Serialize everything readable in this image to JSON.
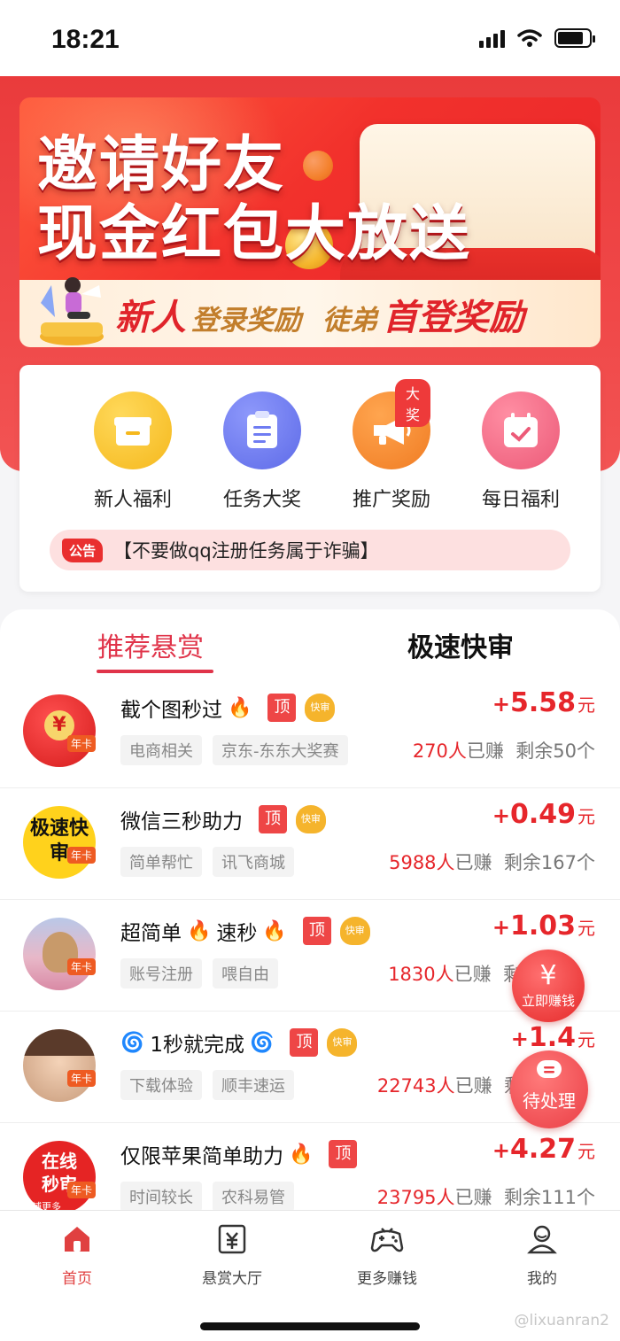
{
  "status_bar": {
    "time": "18:21"
  },
  "banner": {
    "title_line1": "邀请好友",
    "title_line2": "现金红包大放送",
    "strip_new": "新人",
    "strip_login": "登录奖励",
    "strip_apprentice": "徒弟",
    "strip_first": "首登奖励"
  },
  "quick_actions": [
    {
      "label": "新人福利",
      "icon": "gift-box-icon",
      "color": "#f7c027"
    },
    {
      "label": "任务大奖",
      "icon": "clipboard-icon",
      "color": "#6f7cf2"
    },
    {
      "label": "推广奖励",
      "icon": "megaphone-icon",
      "color": "#f5872d",
      "badge": "大奖"
    },
    {
      "label": "每日福利",
      "icon": "calendar-check-icon",
      "color": "#f1607a"
    }
  ],
  "notice": {
    "tag": "公告",
    "text": "【不要做qq注册任务属于诈骗】"
  },
  "tabs": {
    "recommended": "推荐悬赏",
    "fast": "极速快审"
  },
  "tasks": [
    {
      "title": "截个图秒过",
      "top": "顶",
      "fast": "快审",
      "tags": [
        "电商相关",
        "京东-东东大奖赛"
      ],
      "plus": "+",
      "price": "5.58",
      "unit": "元",
      "earned": "270人",
      "earned_suffix": "已赚",
      "remaining": "剩余50个",
      "avatar_text": "¥",
      "avatar_badge": "年卡"
    },
    {
      "title": "微信三秒助力",
      "top": "顶",
      "fast": "快审",
      "tags": [
        "简单帮忙",
        "讯飞商城"
      ],
      "plus": "+",
      "price": "0.49",
      "unit": "元",
      "earned": "5988人",
      "earned_suffix": "已赚",
      "remaining": "剩余167个",
      "avatar_text": "极速快审",
      "avatar_badge": "年卡"
    },
    {
      "title_a": "超简单",
      "title_b": "速秒",
      "top": "顶",
      "fast": "快审",
      "tags": [
        "账号注册",
        "喂自由"
      ],
      "plus": "+",
      "price": "1.03",
      "unit": "元",
      "earned": "1830人",
      "earned_suffix": "已赚",
      "remaining": "剩余",
      "avatar_badge": "年卡"
    },
    {
      "title": "1秒就完成",
      "top": "顶",
      "fast": "快审",
      "tags": [
        "下载体验",
        "顺丰速运"
      ],
      "plus": "+",
      "price": "1.4",
      "unit": "元",
      "earned": "22743人",
      "earned_suffix": "已赚",
      "remaining": "剩",
      "avatar_badge": "年卡"
    },
    {
      "title": "仅限苹果简单助力",
      "top": "顶",
      "tags": [
        "时间较长",
        "农科易管"
      ],
      "plus": "+",
      "price": "4.27",
      "unit": "元",
      "earned": "23795人",
      "earned_suffix": "已赚",
      "remaining": "剩余111个",
      "avatar_text": "在线秒审",
      "avatar_sub": "铺更多",
      "avatar_badge": "年卡"
    }
  ],
  "float_buttons": {
    "earn": "立即赚钱",
    "earn_icon": "¥",
    "pending": "待处理"
  },
  "bottom_nav": [
    {
      "label": "首页",
      "icon": "home-icon",
      "active": true
    },
    {
      "label": "悬赏大厅",
      "icon": "yuan-ticket-icon"
    },
    {
      "label": "更多赚钱",
      "icon": "gamepad-icon"
    },
    {
      "label": "我的",
      "icon": "user-icon"
    }
  ],
  "watermark": "@lixuanran2"
}
